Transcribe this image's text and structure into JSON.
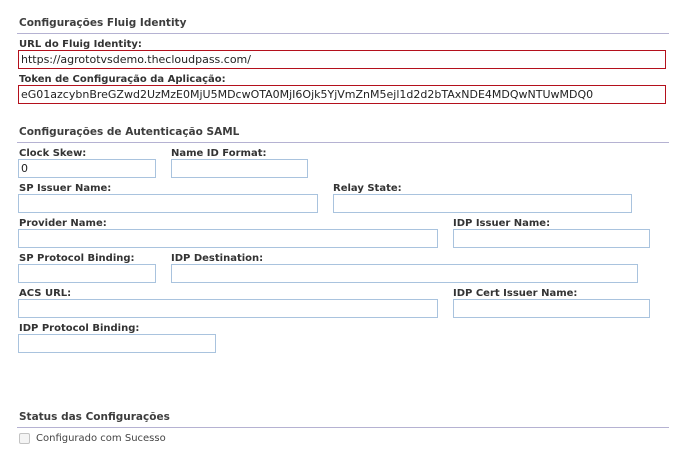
{
  "fluig_section": {
    "title": "Configurações Fluig Identity",
    "url_label": "URL do Fluig Identity:",
    "url_value": "https://agrototvsdemo.thecloudpass.com/",
    "token_label": "Token de Configuração da Aplicação:",
    "token_value": "eG01azcybnBreGZwd2UzMzE0MjU5MDcwOTA0MjI6Ojk5YjVmZnM5ejl1d2d2bTAxNDE4MDQwNTUwMDQ0"
  },
  "saml_section": {
    "title": "Configurações de Autenticação SAML",
    "clock_skew_label": "Clock Skew:",
    "clock_skew_value": "0",
    "name_id_format_label": "Name ID Format:",
    "name_id_format_value": "",
    "sp_issuer_name_label": "SP Issuer Name:",
    "sp_issuer_name_value": "",
    "relay_state_label": "Relay State:",
    "relay_state_value": "",
    "provider_name_label": "Provider Name:",
    "provider_name_value": "",
    "idp_issuer_name_label": "IDP Issuer Name:",
    "idp_issuer_name_value": "",
    "sp_protocol_binding_label": "SP Protocol Binding:",
    "sp_protocol_binding_value": "",
    "idp_destination_label": "IDP Destination:",
    "idp_destination_value": "",
    "acs_url_label": "ACS URL:",
    "acs_url_value": "",
    "idp_cert_issuer_name_label": "IDP Cert Issuer Name:",
    "idp_cert_issuer_name_value": "",
    "idp_protocol_binding_label": "IDP Protocol Binding:",
    "idp_protocol_binding_value": ""
  },
  "status_section": {
    "title": "Status das Configurações",
    "checkbox_label": "Configurado com Sucesso",
    "checkbox_checked": false
  },
  "colors": {
    "section_line": "#b5b2d2",
    "input_border": "#a9c3de",
    "error_border": "#b4101c"
  }
}
